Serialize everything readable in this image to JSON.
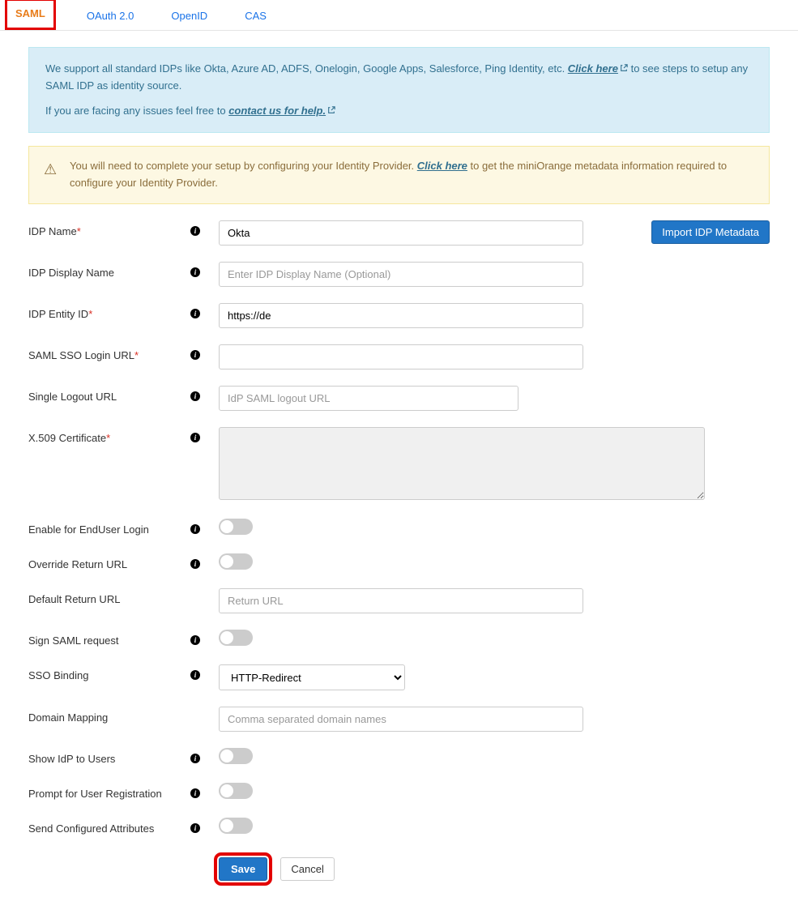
{
  "tabs": {
    "saml": "SAML",
    "oauth": "OAuth 2.0",
    "openid": "OpenID",
    "cas": "CAS"
  },
  "info": {
    "line1_a": "We support all standard IDPs like Okta, Azure AD, ADFS, Onelogin, Google Apps, Salesforce, Ping Identity, etc. ",
    "link1": "Click here",
    "line1_b": " to see steps to setup any SAML IDP as identity source.",
    "line2_a": "If you are facing any issues feel free to ",
    "link2": "contact us for help."
  },
  "warn": {
    "text_a": "You will need to complete your setup by configuring your Identity Provider. ",
    "link": "Click here",
    "text_b": " to get the miniOrange metadata information required to configure your Identity Provider."
  },
  "labels": {
    "idp_name": "IDP Name",
    "idp_display": "IDP Display Name",
    "idp_entity": "IDP Entity ID",
    "sso_url": "SAML SSO Login URL",
    "slo_url": "Single Logout URL",
    "cert": "X.509 Certificate",
    "enable_enduser": "Enable for EndUser Login",
    "override_return": "Override Return URL",
    "default_return": "Default Return URL",
    "sign_request": "Sign SAML request",
    "sso_binding": "SSO Binding",
    "domain_mapping": "Domain Mapping",
    "show_idp": "Show IdP to Users",
    "prompt_reg": "Prompt for User Registration",
    "send_attrs": "Send Configured Attributes"
  },
  "values": {
    "idp_name": "Okta",
    "idp_display_placeholder": "Enter IDP Display Name (Optional)",
    "idp_entity": "https://de",
    "sso_url": "",
    "slo_placeholder": "IdP SAML logout URL",
    "cert": "",
    "default_return_placeholder": "Return URL",
    "sso_binding_selected": "HTTP-Redirect",
    "domain_mapping_placeholder": "Comma separated domain names"
  },
  "buttons": {
    "import_metadata": "Import IDP Metadata",
    "save": "Save",
    "cancel": "Cancel"
  }
}
